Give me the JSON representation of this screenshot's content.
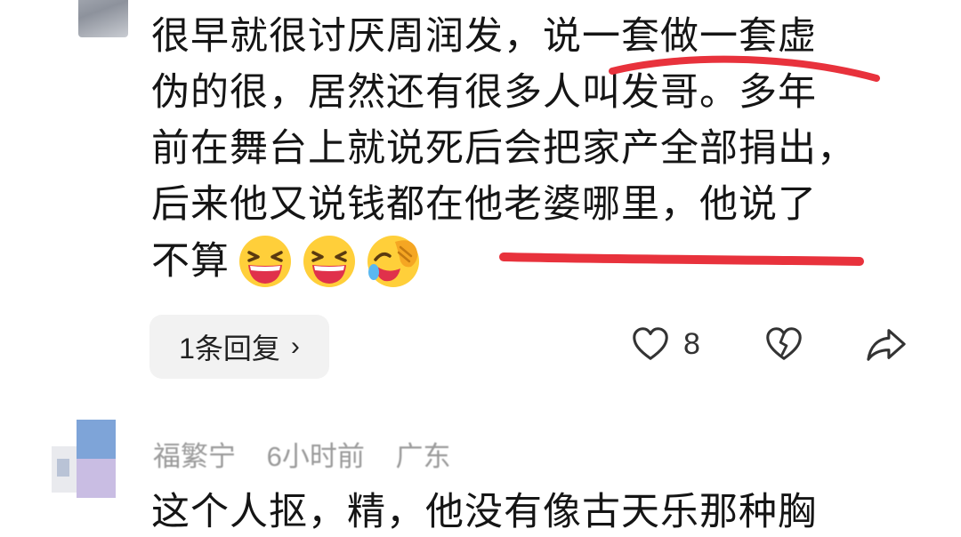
{
  "comment1": {
    "lines": [
      "很早就很讨厌周润发，说一套做一套虚",
      "伪的很，居然还有很多人叫发哥。多年",
      "前在舞台上就说死后会把家产全部捐出，",
      "后来他又说钱都在他老婆哪里，他说了",
      "不算"
    ],
    "emojis": [
      "grinning-squint-emoji",
      "grinning-squint-emoji",
      "rolling-laughing-emoji"
    ],
    "underline_color": "#e8323c"
  },
  "actions": {
    "reply_label": "1条回复",
    "reply_chevron": "›",
    "like_count": "8",
    "icons": [
      "heart-icon",
      "broken-heart-icon",
      "share-icon"
    ]
  },
  "comment2": {
    "author": "福繁宁",
    "time": "6小时前",
    "location": "广东",
    "text": "这个人抠，精，他没有像古天乐那种胸"
  }
}
